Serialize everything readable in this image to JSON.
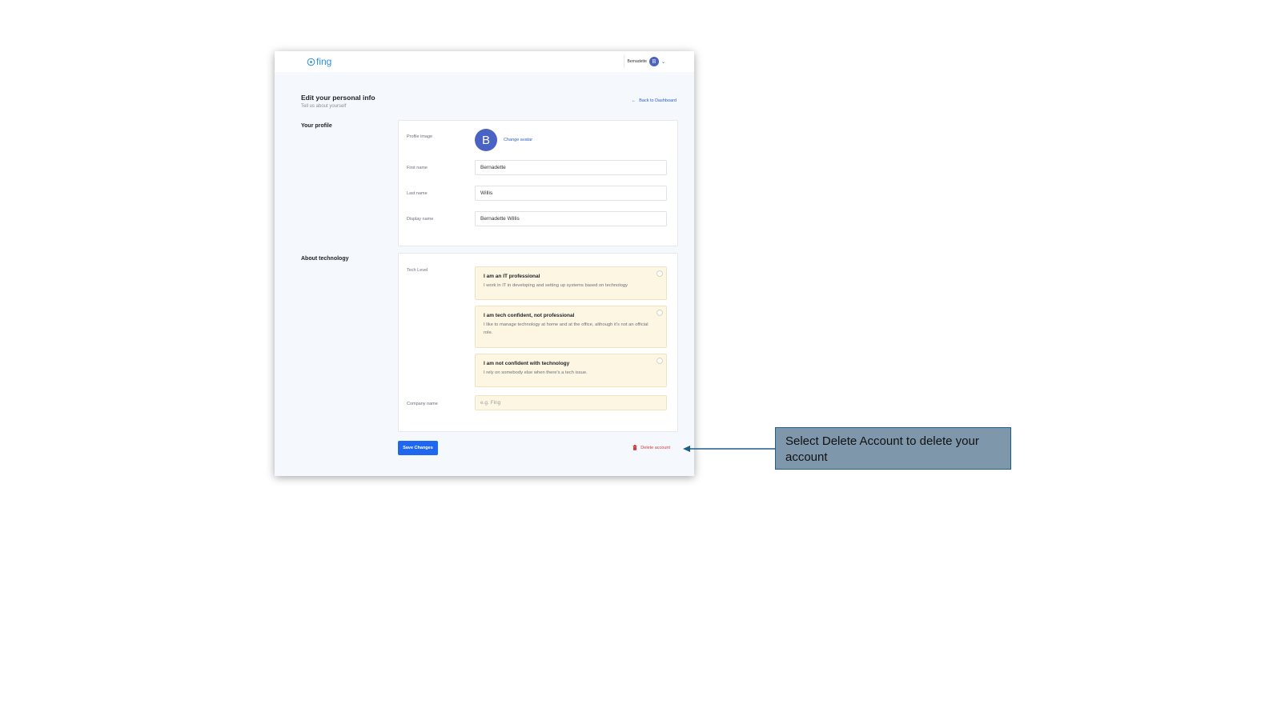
{
  "app": {
    "logo_text": "fing",
    "brand_color": "#2f8fd8"
  },
  "header": {
    "user_name": "Bernadette",
    "user_initial": "B"
  },
  "page": {
    "title": "Edit your personal info",
    "subtitle": "Tell us about yourself",
    "back_link": "Back to Dashboard"
  },
  "profile": {
    "section_label": "Your profile",
    "profile_image_label": "Profile image",
    "avatar_initial": "B",
    "change_avatar": "Change avatar",
    "first_name_label": "First name",
    "first_name_value": "Bernadette",
    "last_name_label": "Last name",
    "last_name_value": "Willis",
    "display_name_label": "Display name",
    "display_name_value": "Bernadette Willis"
  },
  "technology": {
    "section_label": "About technology",
    "tech_level_label": "Tech Level",
    "options": [
      {
        "title": "I am an IT professional",
        "desc": "I work in IT in developing and setting up systems based on technology"
      },
      {
        "title": "I am tech confident, not professional",
        "desc": "I like to manage technology at home and at the office, although it's not an official role."
      },
      {
        "title": "I am not confident with technology",
        "desc": "I rely on somebody else when there's a tech issue."
      }
    ],
    "company_label": "Company name",
    "company_placeholder": "e.g. Fing"
  },
  "actions": {
    "save": "Save Changes",
    "delete": "Delete account"
  },
  "callout": {
    "text": "Select Delete Account to delete your account"
  },
  "colors": {
    "primary": "#1f66f0",
    "danger": "#d43a3a",
    "option_bg": "#fdf6e2",
    "callout_bg": "#7e97ab"
  }
}
